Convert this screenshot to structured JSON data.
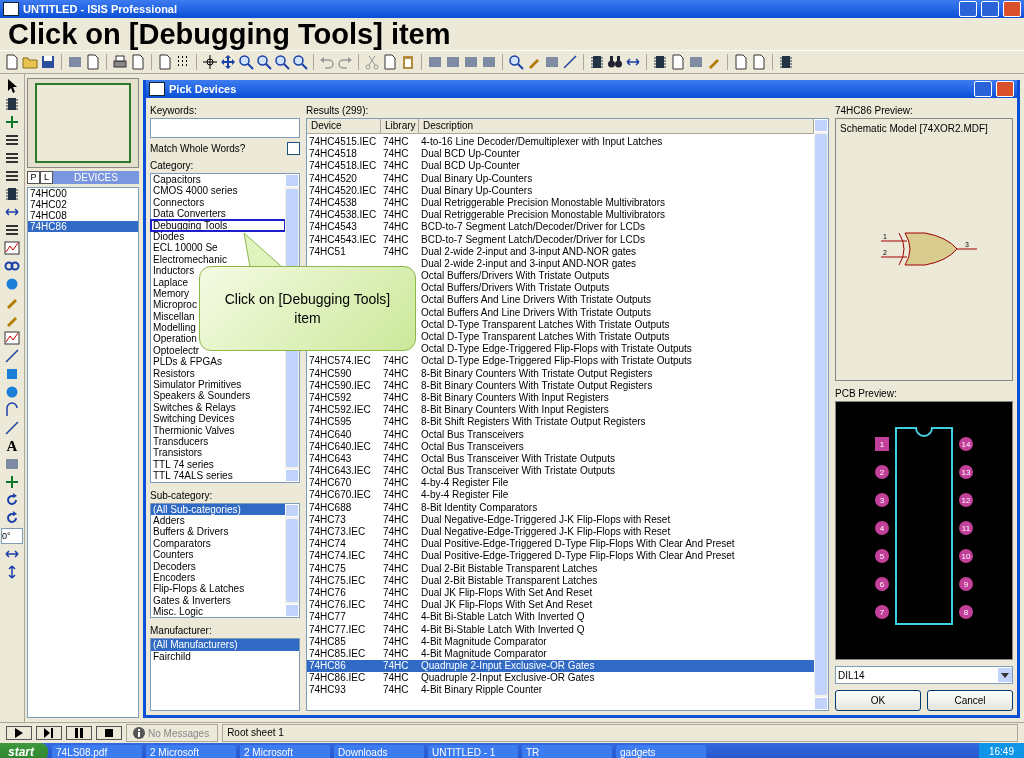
{
  "window": {
    "title": "UNTITLED - ISIS Professional"
  },
  "headline": "Click on [Debugging Tools] item",
  "left_toolbar": {
    "text_tool": "A",
    "rotation": "0°"
  },
  "sidebar": {
    "tabs": [
      {
        "label": "P",
        "selected": false
      },
      {
        "label": "L",
        "selected": false
      }
    ],
    "heading": "DEVICES",
    "items": [
      {
        "label": "74HC00",
        "selected": false
      },
      {
        "label": "74HC02",
        "selected": false
      },
      {
        "label": "74HC08",
        "selected": false
      },
      {
        "label": "74HC86",
        "selected": true
      }
    ]
  },
  "dialog": {
    "title": "Pick Devices",
    "keywords_label": "Keywords:",
    "match_whole_words": {
      "label": "Match Whole Words?",
      "checked": false
    },
    "category": {
      "label": "Category:",
      "items": [
        {
          "label": "Capacitors",
          "selected": false,
          "highlighted": false
        },
        {
          "label": "CMOS 4000 series",
          "selected": false,
          "highlighted": false
        },
        {
          "label": "Connectors",
          "selected": false,
          "highlighted": false
        },
        {
          "label": "Data Converters",
          "selected": false,
          "highlighted": false
        },
        {
          "label": "Debugging Tools",
          "selected": false,
          "highlighted": true
        },
        {
          "label": "Diodes",
          "selected": false,
          "highlighted": false
        },
        {
          "label": "ECL 10000 Se",
          "selected": false,
          "highlighted": false
        },
        {
          "label": "Electromechanic",
          "selected": false,
          "highlighted": false
        },
        {
          "label": "Inductors",
          "selected": false,
          "highlighted": false
        },
        {
          "label": "Laplace",
          "selected": false,
          "highlighted": false
        },
        {
          "label": "Memory",
          "selected": false,
          "highlighted": false
        },
        {
          "label": "Microproc",
          "selected": false,
          "highlighted": false
        },
        {
          "label": "Miscellan",
          "selected": false,
          "highlighted": false
        },
        {
          "label": "Modelling",
          "selected": false,
          "highlighted": false
        },
        {
          "label": "Operation",
          "selected": false,
          "highlighted": false
        },
        {
          "label": "Optoelectr",
          "selected": false,
          "highlighted": false
        },
        {
          "label": "PLDs & FPGAs",
          "selected": false,
          "highlighted": false
        },
        {
          "label": "Resistors",
          "selected": false,
          "highlighted": false
        },
        {
          "label": "Simulator Primitives",
          "selected": false,
          "highlighted": false
        },
        {
          "label": "Speakers & Sounders",
          "selected": false,
          "highlighted": false
        },
        {
          "label": "Switches & Relays",
          "selected": false,
          "highlighted": false
        },
        {
          "label": "Switching Devices",
          "selected": false,
          "highlighted": false
        },
        {
          "label": "Thermionic Valves",
          "selected": false,
          "highlighted": false
        },
        {
          "label": "Transducers",
          "selected": false,
          "highlighted": false
        },
        {
          "label": "Transistors",
          "selected": false,
          "highlighted": false
        },
        {
          "label": "TTL 74 series",
          "selected": false,
          "highlighted": false
        },
        {
          "label": "TTL 74ALS series",
          "selected": false,
          "highlighted": false
        }
      ]
    },
    "subcategory": {
      "label": "Sub-category:",
      "items": [
        {
          "label": "(All Sub-categories)",
          "selected": true
        },
        {
          "label": "Adders",
          "selected": false
        },
        {
          "label": "Buffers & Drivers",
          "selected": false
        },
        {
          "label": "Comparators",
          "selected": false
        },
        {
          "label": "Counters",
          "selected": false
        },
        {
          "label": "Decoders",
          "selected": false
        },
        {
          "label": "Encoders",
          "selected": false
        },
        {
          "label": "Flip-Flops & Latches",
          "selected": false
        },
        {
          "label": "Gates & Inverters",
          "selected": false
        },
        {
          "label": "Misc. Logic",
          "selected": false
        }
      ]
    },
    "manufacturer": {
      "label": "Manufacturer:",
      "items": [
        {
          "label": "(All Manufacturers)",
          "selected": true
        },
        {
          "label": "Fairchild",
          "selected": false
        }
      ]
    },
    "results": {
      "label": "Results (299):",
      "columns": [
        "Device",
        "Library",
        "Description"
      ],
      "rows": [
        {
          "device": "74HC4515.IEC",
          "library": "74HC",
          "description": "4-to-16 Line Decoder/Demultiplexer with Input Latches",
          "selected": false
        },
        {
          "device": "74HC4518",
          "library": "74HC",
          "description": "Dual BCD Up-Counter",
          "selected": false
        },
        {
          "device": "74HC4518.IEC",
          "library": "74HC",
          "description": "Dual BCD Up-Counter",
          "selected": false
        },
        {
          "device": "74HC4520",
          "library": "74HC",
          "description": "Dual Binary Up-Counters",
          "selected": false
        },
        {
          "device": "74HC4520.IEC",
          "library": "74HC",
          "description": "Dual Binary Up-Counters",
          "selected": false
        },
        {
          "device": "74HC4538",
          "library": "74HC",
          "description": "Dual Retriggerable Precision Monostable Multivibrators",
          "selected": false
        },
        {
          "device": "74HC4538.IEC",
          "library": "74HC",
          "description": "Dual Retriggerable Precision Monostable Multivibrators",
          "selected": false
        },
        {
          "device": "74HC4543",
          "library": "74HC",
          "description": "BCD-to-7 Segment Latch/Decoder/Driver for LCDs",
          "selected": false
        },
        {
          "device": "74HC4543.IEC",
          "library": "74HC",
          "description": "BCD-to-7 Segment Latch/Decoder/Driver for LCDs",
          "selected": false
        },
        {
          "device": "74HC51",
          "library": "74HC",
          "description": "Dual 2-wide 2-input and 3-input AND-NOR gates",
          "selected": false
        },
        {
          "description": "Dual 2-wide 2-input and 3-input AND-NOR gates",
          "selected": false
        },
        {
          "description": "Octal Buffers/Drivers With Tristate Outputs",
          "selected": false
        },
        {
          "description": "Octal Buffers/Drivers With Tristate Outputs",
          "selected": false
        },
        {
          "description": "Octal Buffers And Line Drivers With Tristate Outputs",
          "selected": false
        },
        {
          "description": "Octal Buffers And Line Drivers With Tristate Outputs",
          "selected": false
        },
        {
          "description": "Octal D-Type Transparent Latches With Tristate Outputs",
          "selected": false
        },
        {
          "description": "Octal D-Type Transparent Latches With Tristate Outputs",
          "selected": false
        },
        {
          "description": "Octal D-Type Edge-Triggered Flip-Flops with Tristate Outputs",
          "selected": false
        },
        {
          "device": "74HC574.IEC",
          "library": "74HC",
          "description": "Octal D-Type Edge-Triggered Flip-Flops with Tristate Outputs",
          "selected": false
        },
        {
          "device": "74HC590",
          "library": "74HC",
          "description": "8-Bit Binary Counters With Tristate Output Registers",
          "selected": false
        },
        {
          "device": "74HC590.IEC",
          "library": "74HC",
          "description": "8-Bit Binary Counters With Tristate Output Registers",
          "selected": false
        },
        {
          "device": "74HC592",
          "library": "74HC",
          "description": "8-Bit Binary Counters With Input Registers",
          "selected": false
        },
        {
          "device": "74HC592.IEC",
          "library": "74HC",
          "description": "8-Bit Binary Counters With Input Registers",
          "selected": false
        },
        {
          "device": "74HC595",
          "library": "74HC",
          "description": "8-Bit Shift Registers With Tristate Output Registers",
          "selected": false
        },
        {
          "device": "74HC640",
          "library": "74HC",
          "description": "Octal Bus Transceivers",
          "selected": false
        },
        {
          "device": "74HC640.IEC",
          "library": "74HC",
          "description": "Octal Bus Transceivers",
          "selected": false
        },
        {
          "device": "74HC643",
          "library": "74HC",
          "description": "Octal Bus Transceiver With Tristate Outputs",
          "selected": false
        },
        {
          "device": "74HC643.IEC",
          "library": "74HC",
          "description": "Octal Bus Transceiver With Tristate Outputs",
          "selected": false
        },
        {
          "device": "74HC670",
          "library": "74HC",
          "description": "4-by-4 Register File",
          "selected": false
        },
        {
          "device": "74HC670.IEC",
          "library": "74HC",
          "description": "4-by-4 Register File",
          "selected": false
        },
        {
          "device": "74HC688",
          "library": "74HC",
          "description": "8-Bit Identity Comparators",
          "selected": false
        },
        {
          "device": "74HC73",
          "library": "74HC",
          "description": "Dual Negative-Edge-Triggered J-K Flip-Flops with Reset",
          "selected": false
        },
        {
          "device": "74HC73.IEC",
          "library": "74HC",
          "description": "Dual Negative-Edge-Triggered J-K Flip-Flops with Reset",
          "selected": false
        },
        {
          "device": "74HC74",
          "library": "74HC",
          "description": "Dual Positive-Edge-Triggered D-Type Flip-Flops With Clear And Preset",
          "selected": false
        },
        {
          "device": "74HC74.IEC",
          "library": "74HC",
          "description": "Dual Positive-Edge-Triggered D-Type Flip-Flops With Clear And Preset",
          "selected": false
        },
        {
          "device": "74HC75",
          "library": "74HC",
          "description": "Dual 2-Bit Bistable Transparent Latches",
          "selected": false
        },
        {
          "device": "74HC75.IEC",
          "library": "74HC",
          "description": "Dual 2-Bit Bistable Transparent Latches",
          "selected": false
        },
        {
          "device": "74HC76",
          "library": "74HC",
          "description": "Dual JK Flip-Flops With Set And Reset",
          "selected": false
        },
        {
          "device": "74HC76.IEC",
          "library": "74HC",
          "description": "Dual JK Flip-Flops With Set And Reset",
          "selected": false
        },
        {
          "device": "74HC77",
          "library": "74HC",
          "description": "4-Bit Bi-Stable Latch With Inverted Q",
          "selected": false
        },
        {
          "device": "74HC77.IEC",
          "library": "74HC",
          "description": "4-Bit Bi-Stable Latch With Inverted Q",
          "selected": false
        },
        {
          "device": "74HC85",
          "library": "74HC",
          "description": "4-Bit Magnitude Comparator",
          "selected": false
        },
        {
          "device": "74HC85.IEC",
          "library": "74HC",
          "description": "4-Bit Magnitude Comparator",
          "selected": false
        },
        {
          "device": "74HC86",
          "library": "74HC",
          "description": "Quadruple 2-Input Exclusive-OR Gates",
          "selected": true
        },
        {
          "device": "74HC86.IEC",
          "library": "74HC",
          "description": "Quadruple 2-Input Exclusive-OR Gates",
          "selected": false
        },
        {
          "device": "74HC93",
          "library": "74HC",
          "description": "4-Bit Binary Ripple Counter",
          "selected": false
        }
      ]
    },
    "preview": {
      "label": "74HC86 Preview:",
      "model": "Schematic Model [74XOR2.MDF]",
      "pins": [
        "1",
        "2",
        "3"
      ]
    },
    "pcb_preview": {
      "label": "PCB Preview:",
      "pins": [
        "1",
        "14",
        "2",
        "13",
        "3",
        "12",
        "4",
        "11",
        "5",
        "10",
        "6",
        "9",
        "7",
        "8"
      ],
      "package": "DIL14"
    },
    "buttons": [
      {
        "label": "OK"
      },
      {
        "label": "Cancel"
      }
    ],
    "callout": {
      "text": "Click on [Debugging Tools] item"
    }
  },
  "status_bar": {
    "message": "No Messages",
    "sheet": "Root sheet 1"
  },
  "taskbar": {
    "start": "start",
    "items": [
      "74LS08.pdf",
      "2 Microsoft",
      "2 Microsoft",
      "Downloads",
      "UNTITLED - 1",
      "TR",
      "gadgets"
    ],
    "clock": "16:49"
  }
}
